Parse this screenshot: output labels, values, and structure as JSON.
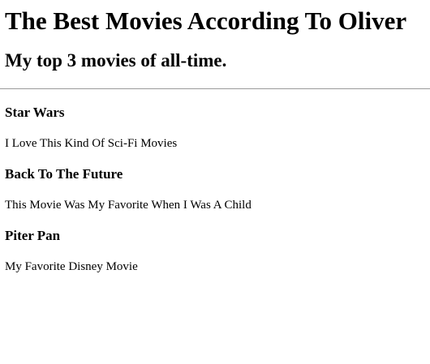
{
  "page": {
    "title": "The Best Movies According To Oliver",
    "subtitle": "My top 3 movies of all-time."
  },
  "movies": [
    {
      "title": "Star Wars",
      "description": "I Love This Kind Of Sci-Fi Movies"
    },
    {
      "title": "Back To The Future",
      "description": "This Movie Was My Favorite When I Was A Child"
    },
    {
      "title": "Piter Pan",
      "description": "My Favorite Disney Movie"
    }
  ]
}
